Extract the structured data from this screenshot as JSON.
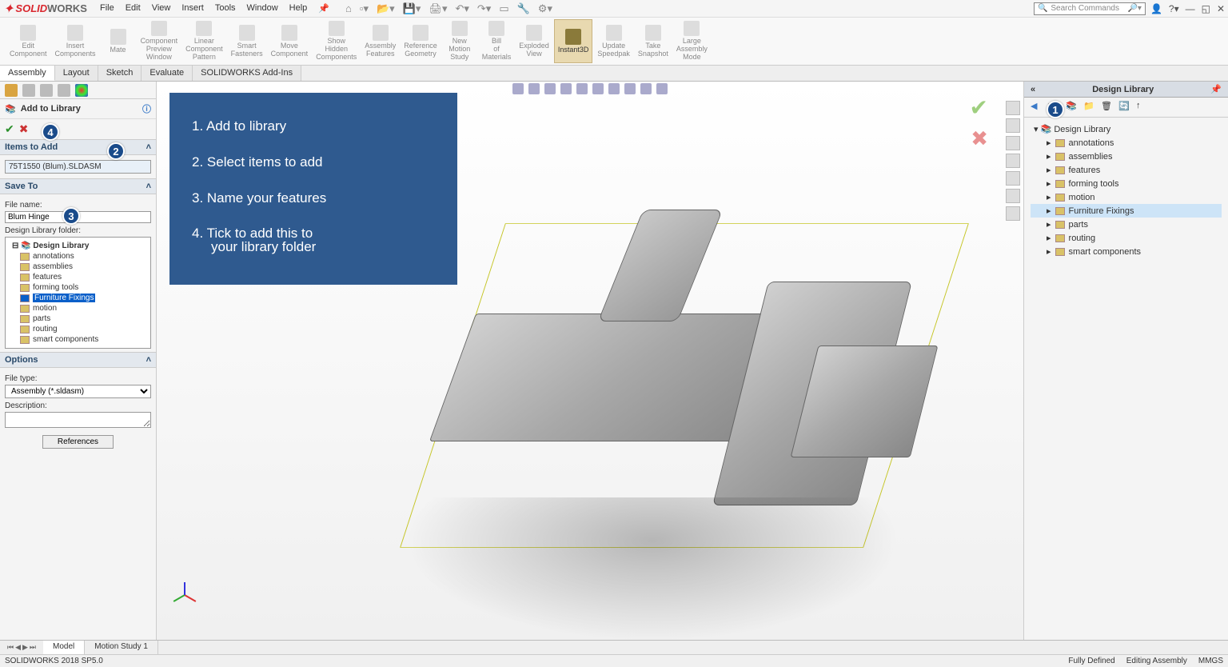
{
  "app": {
    "name_red": "SOLID",
    "name_gray": "WORKS"
  },
  "menu": [
    "File",
    "Edit",
    "View",
    "Insert",
    "Tools",
    "Window",
    "Help"
  ],
  "search_placeholder": "Search Commands",
  "ribbon": [
    {
      "label": "Edit Component"
    },
    {
      "label": "Insert Components"
    },
    {
      "label": "Mate"
    },
    {
      "label": "Component Preview Window"
    },
    {
      "label": "Linear Component Pattern"
    },
    {
      "label": "Smart Fasteners"
    },
    {
      "label": "Move Component"
    },
    {
      "label": "Show Hidden Components"
    },
    {
      "label": "Assembly Features"
    },
    {
      "label": "Reference Geometry"
    },
    {
      "label": "New Motion Study"
    },
    {
      "label": "Bill of Materials"
    },
    {
      "label": "Exploded View"
    },
    {
      "label": "Instant3D",
      "active": true
    },
    {
      "label": "Update Speedpak"
    },
    {
      "label": "Take Snapshot"
    },
    {
      "label": "Large Assembly Mode"
    }
  ],
  "tabs": [
    "Assembly",
    "Layout",
    "Sketch",
    "Evaluate",
    "SOLIDWORKS Add-Ins"
  ],
  "active_tab": "Assembly",
  "left": {
    "title": "Add to Library",
    "section_items": "Items to Add",
    "item_value": "75T1550 (Blum).SLDASM",
    "section_save": "Save To",
    "filename_label": "File name:",
    "filename_value": "Blum Hinge",
    "libfolder_label": "Design Library folder:",
    "tree_root": "Design Library",
    "tree": [
      "annotations",
      "assemblies",
      "features",
      "forming tools",
      "Furniture Fixings",
      "motion",
      "parts",
      "routing",
      "smart components"
    ],
    "tree_selected": "Furniture Fixings",
    "section_options": "Options",
    "filetype_label": "File type:",
    "filetype_value": "Assembly (*.sldasm)",
    "desc_label": "Description:",
    "references_btn": "References"
  },
  "callout": [
    "1. Add to library",
    "2. Select items to add",
    "3. Name your features",
    "4. Tick to add this to",
    "    your library folder"
  ],
  "badges": [
    "1",
    "2",
    "3",
    "4"
  ],
  "right": {
    "title": "Design Library",
    "tree_root": "Design Library",
    "items": [
      "annotations",
      "assemblies",
      "features",
      "forming tools",
      "motion",
      "Furniture Fixings",
      "parts",
      "routing",
      "smart components"
    ],
    "selected": "Furniture Fixings"
  },
  "bottom_tabs": [
    "Model",
    "Motion Study 1"
  ],
  "status": {
    "left": "SOLIDWORKS 2018 SP5.0",
    "a": "Fully Defined",
    "b": "Editing Assembly",
    "c": "MMGS"
  }
}
